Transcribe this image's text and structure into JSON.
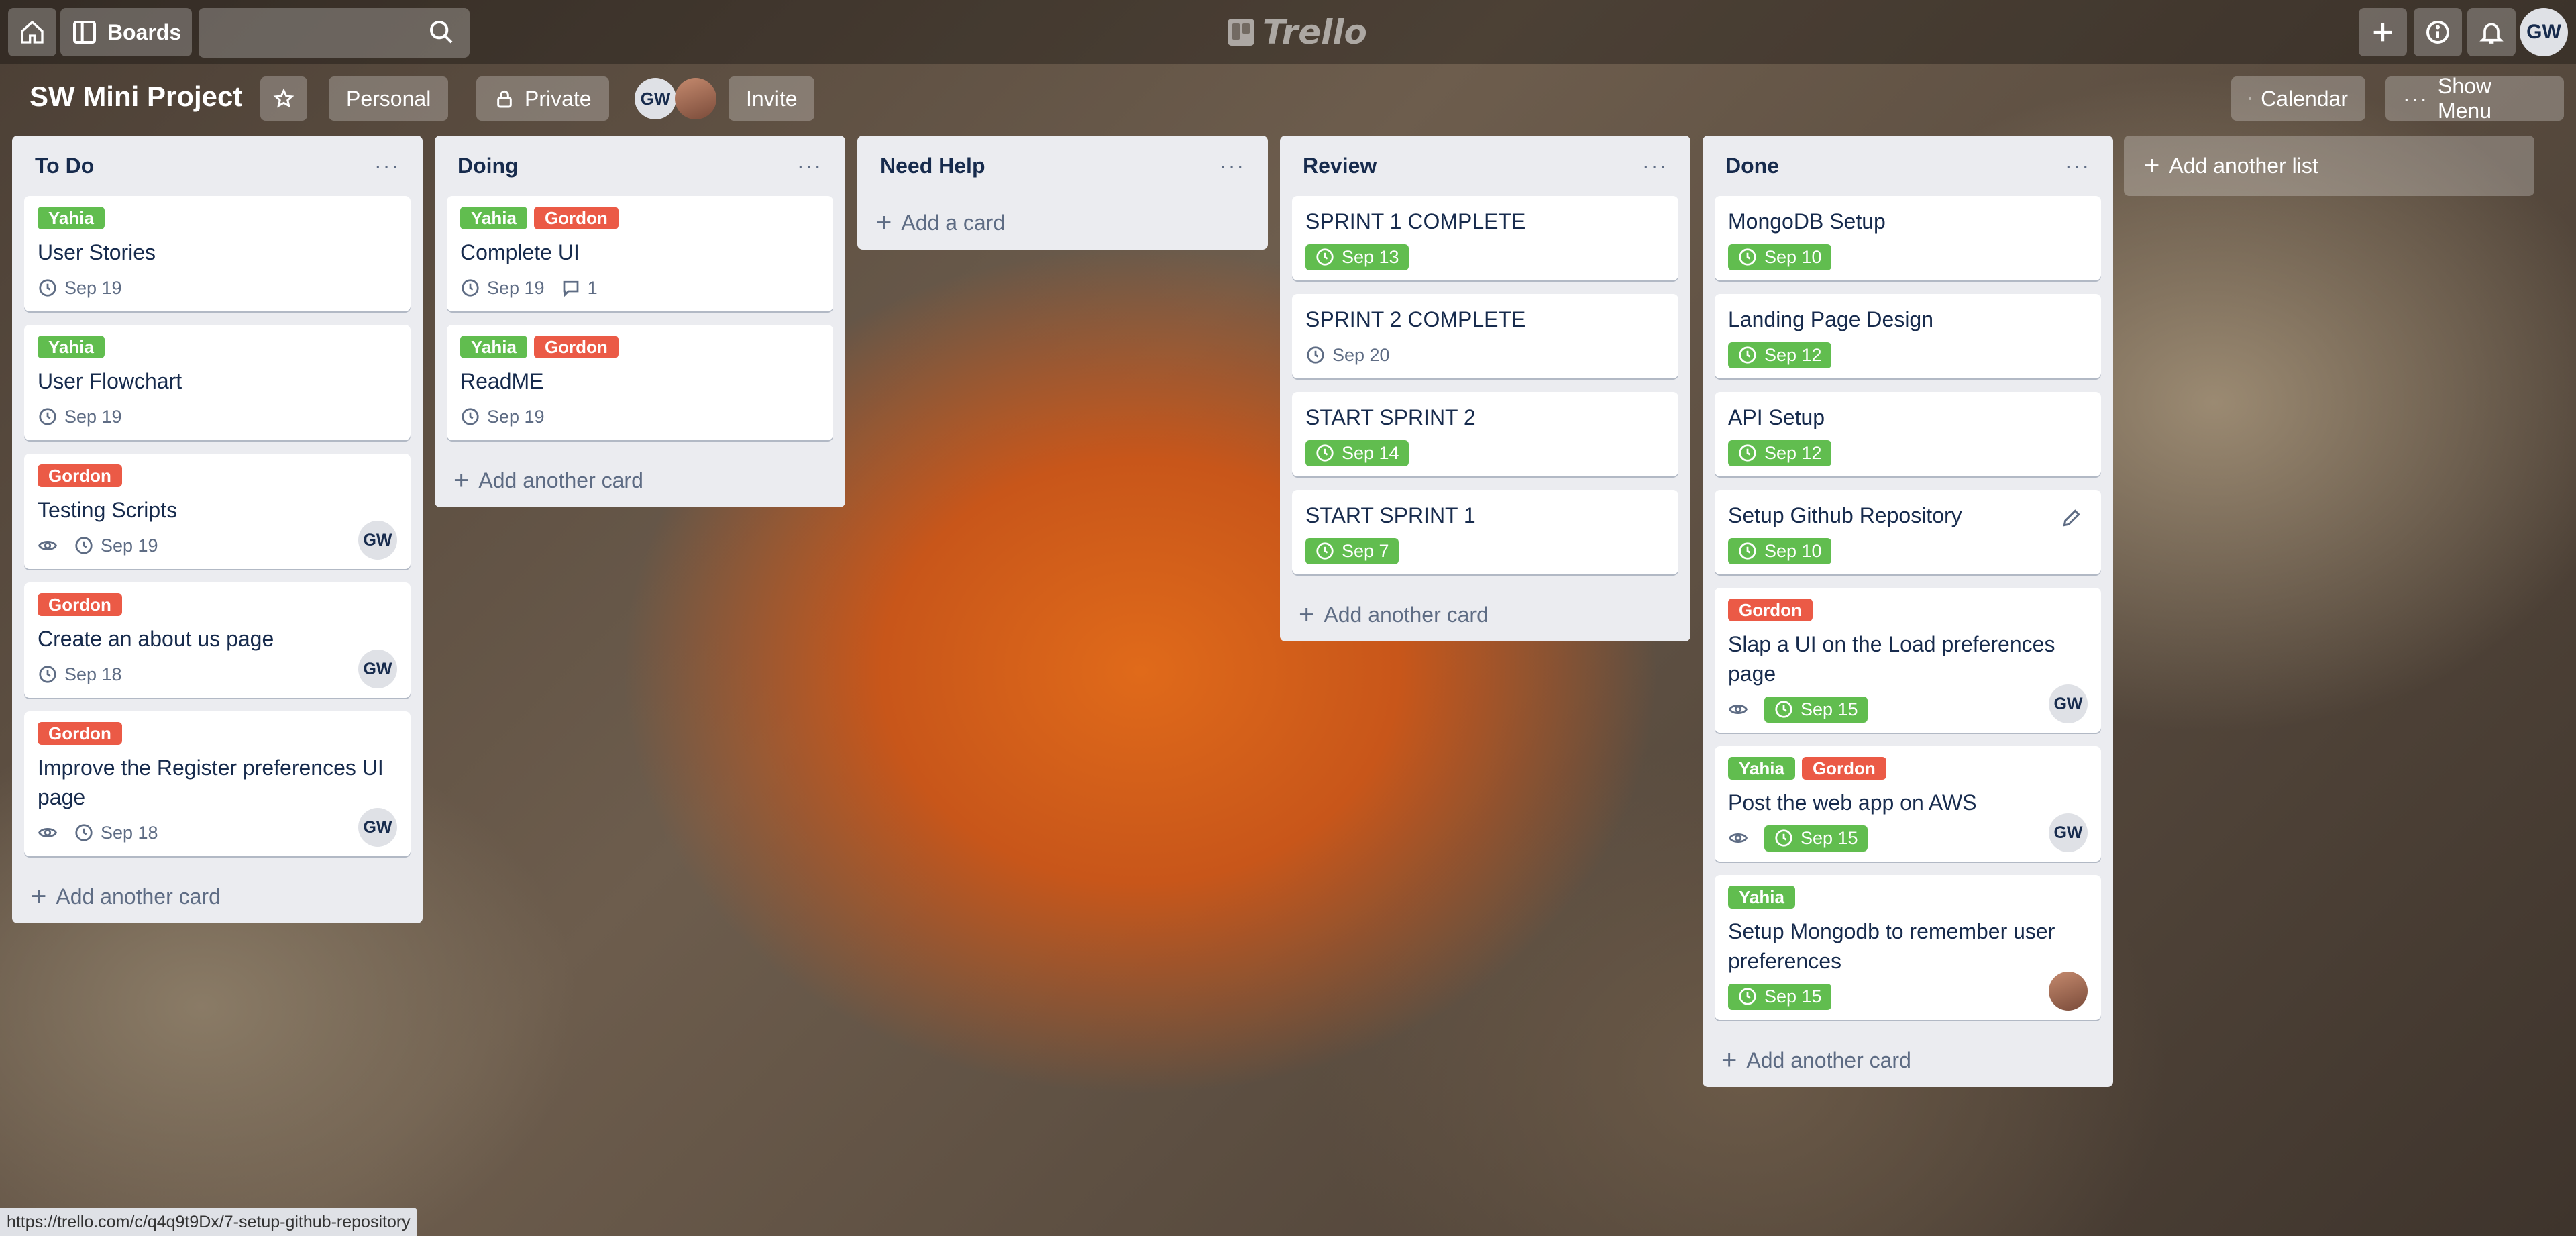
{
  "topbar": {
    "boards_label": "Boards",
    "search_placeholder": "",
    "logo_text": "Trello",
    "user_initials": "GW"
  },
  "board": {
    "title": "SW Mini Project",
    "visibility_team": "Personal",
    "visibility_privacy": "Private",
    "member_initials": "GW",
    "invite_label": "Invite",
    "calendar_label": "Calendar",
    "show_menu_label": "Show Menu"
  },
  "lists": [
    {
      "title": "To Do",
      "add_label": "Add another card",
      "cards": [
        {
          "labels": [
            {
              "text": "Yahia",
              "color": "#61bd4f"
            }
          ],
          "title": "User Stories",
          "watch": false,
          "due": "Sep 19",
          "due_complete": false,
          "comments": null,
          "member": null
        },
        {
          "labels": [
            {
              "text": "Yahia",
              "color": "#61bd4f"
            }
          ],
          "title": "User Flowchart",
          "watch": false,
          "due": "Sep 19",
          "due_complete": false,
          "comments": null,
          "member": null
        },
        {
          "labels": [
            {
              "text": "Gordon",
              "color": "#eb5a46"
            }
          ],
          "title": "Testing Scripts",
          "watch": true,
          "due": "Sep 19",
          "due_complete": false,
          "comments": null,
          "member": "GW"
        },
        {
          "labels": [
            {
              "text": "Gordon",
              "color": "#eb5a46"
            }
          ],
          "title": "Create an about us page",
          "watch": false,
          "due": "Sep 18",
          "due_complete": false,
          "comments": null,
          "member": "GW"
        },
        {
          "labels": [
            {
              "text": "Gordon",
              "color": "#eb5a46"
            }
          ],
          "title": "Improve the Register preferences UI page",
          "watch": true,
          "due": "Sep 18",
          "due_complete": false,
          "comments": null,
          "member": "GW"
        }
      ]
    },
    {
      "title": "Doing",
      "add_label": "Add another card",
      "cards": [
        {
          "labels": [
            {
              "text": "Yahia",
              "color": "#61bd4f"
            },
            {
              "text": "Gordon",
              "color": "#eb5a46"
            }
          ],
          "title": "Complete UI",
          "watch": false,
          "due": "Sep 19",
          "due_complete": false,
          "comments": "1",
          "member": null
        },
        {
          "labels": [
            {
              "text": "Yahia",
              "color": "#61bd4f"
            },
            {
              "text": "Gordon",
              "color": "#eb5a46"
            }
          ],
          "title": "ReadME",
          "watch": false,
          "due": "Sep 19",
          "due_complete": false,
          "comments": null,
          "member": null
        }
      ]
    },
    {
      "title": "Need Help",
      "add_label": "Add a card",
      "cards": []
    },
    {
      "title": "Review",
      "add_label": "Add another card",
      "cards": [
        {
          "labels": [],
          "title": "SPRINT 1 COMPLETE",
          "watch": false,
          "due": "Sep 13",
          "due_complete": true,
          "comments": null,
          "member": null
        },
        {
          "labels": [],
          "title": "SPRINT 2 COMPLETE",
          "watch": false,
          "due": "Sep 20",
          "due_complete": false,
          "comments": null,
          "member": null
        },
        {
          "labels": [],
          "title": "START SPRINT 2",
          "watch": false,
          "due": "Sep 14",
          "due_complete": true,
          "comments": null,
          "member": null
        },
        {
          "labels": [],
          "title": "START SPRINT 1",
          "watch": false,
          "due": "Sep 7",
          "due_complete": true,
          "comments": null,
          "member": null
        }
      ]
    },
    {
      "title": "Done",
      "add_label": "Add another card",
      "cards": [
        {
          "labels": [],
          "title": "MongoDB Setup",
          "watch": false,
          "due": "Sep 10",
          "due_complete": true,
          "comments": null,
          "member": null
        },
        {
          "labels": [],
          "title": "Landing Page Design",
          "watch": false,
          "due": "Sep 12",
          "due_complete": true,
          "comments": null,
          "member": null
        },
        {
          "labels": [],
          "title": "API Setup",
          "watch": false,
          "due": "Sep 12",
          "due_complete": true,
          "comments": null,
          "member": null
        },
        {
          "labels": [],
          "title": "Setup Github Repository",
          "watch": false,
          "due": "Sep 10",
          "due_complete": true,
          "comments": null,
          "member": null,
          "hovered": true
        },
        {
          "labels": [
            {
              "text": "Gordon",
              "color": "#eb5a46"
            }
          ],
          "title": "Slap a UI on the Load preferences page",
          "watch": true,
          "due": "Sep 15",
          "due_complete": true,
          "comments": null,
          "member": "GW"
        },
        {
          "labels": [
            {
              "text": "Yahia",
              "color": "#61bd4f"
            },
            {
              "text": "Gordon",
              "color": "#eb5a46"
            }
          ],
          "title": "Post the web app on AWS",
          "watch": true,
          "due": "Sep 15",
          "due_complete": true,
          "comments": null,
          "member": "GW"
        },
        {
          "labels": [
            {
              "text": "Yahia",
              "color": "#61bd4f"
            }
          ],
          "title": "Setup Mongodb to remember user preferences",
          "watch": false,
          "due": "Sep 15",
          "due_complete": true,
          "comments": null,
          "member": "photo"
        }
      ]
    }
  ],
  "add_list_label": "Add another list",
  "status_url": "https://trello.com/c/q4q9t9Dx/7-setup-github-repository",
  "colors": {
    "label_green": "#61bd4f",
    "label_red": "#eb5a46",
    "list_bg": "#ebecf0"
  }
}
